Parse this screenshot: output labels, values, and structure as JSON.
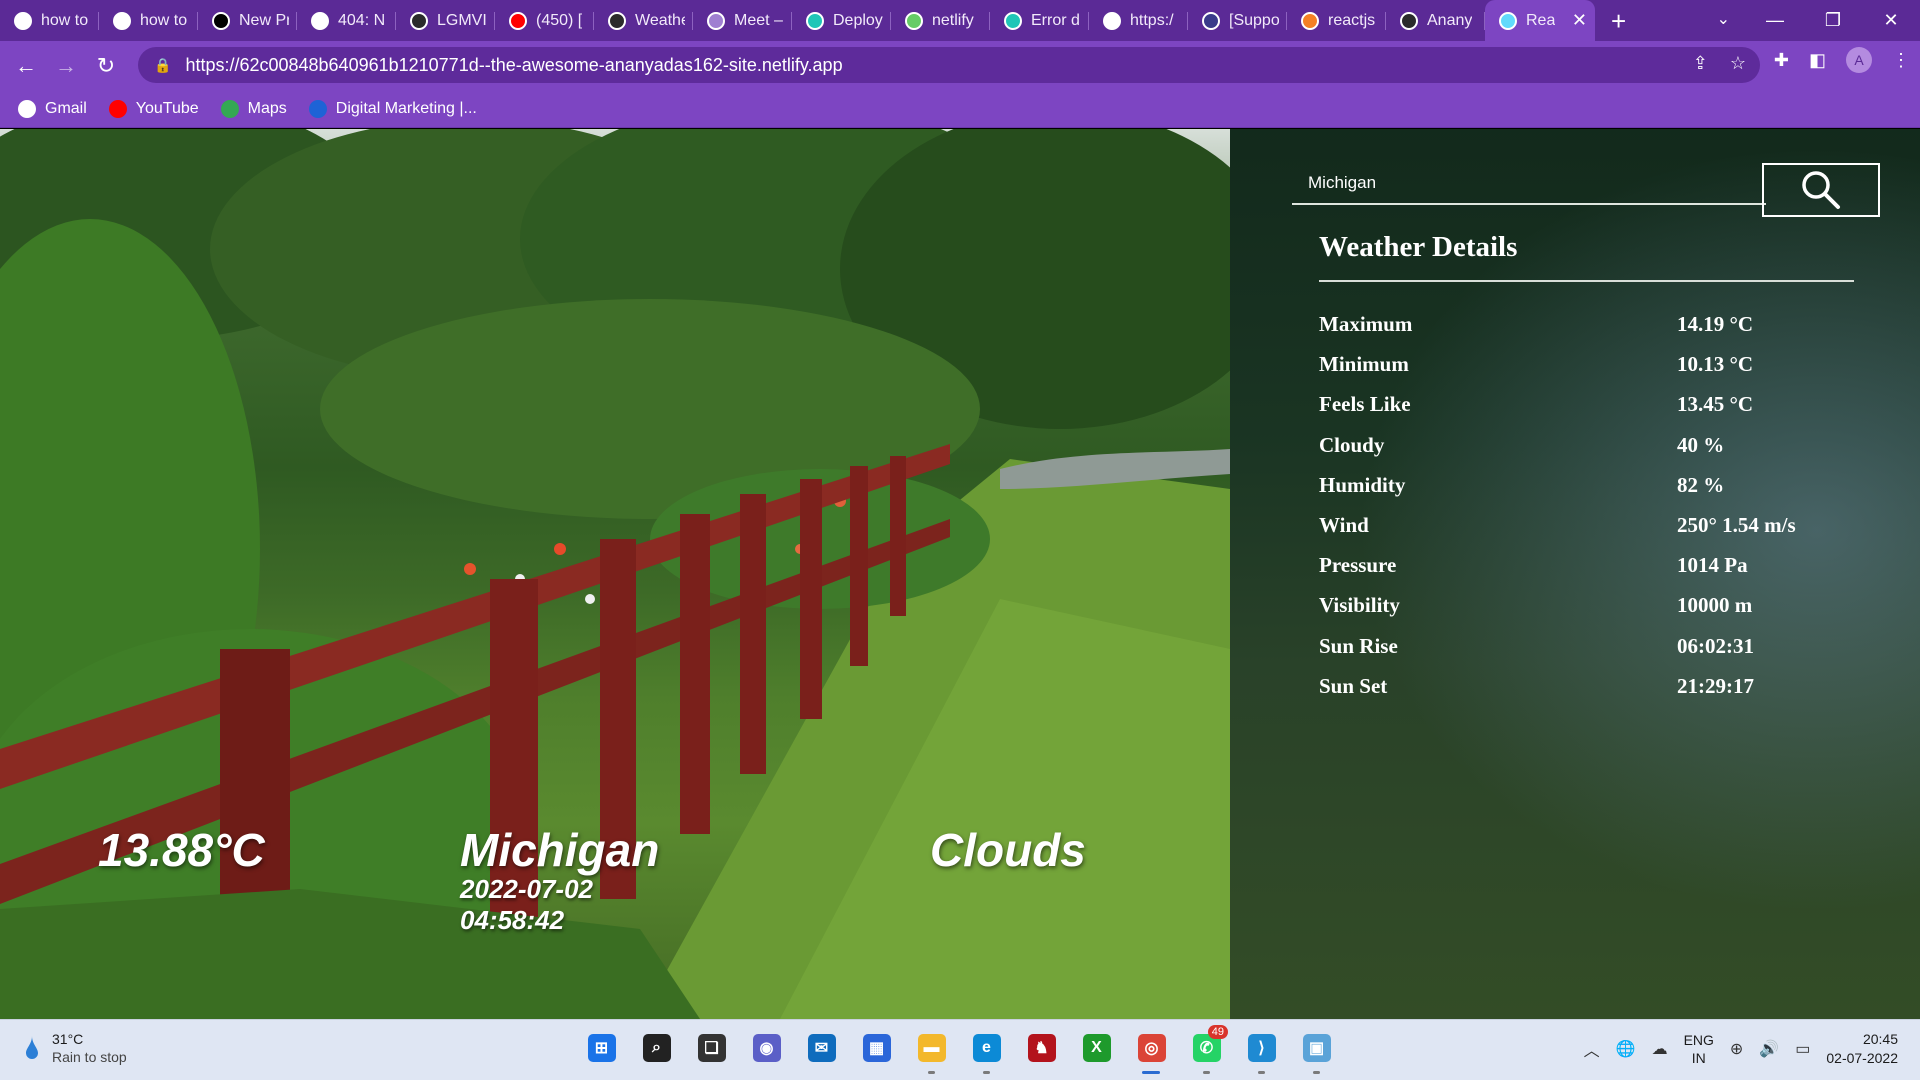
{
  "browser": {
    "tabs": [
      {
        "title": "how to",
        "icon": "google-icon",
        "color": "#ffffff"
      },
      {
        "title": "how to",
        "icon": "google-icon",
        "color": "#ffffff"
      },
      {
        "title": "New Pr",
        "icon": "vercel-icon",
        "color": "#000000"
      },
      {
        "title": "404: N",
        "icon": "globe-icon",
        "color": "#ffffff"
      },
      {
        "title": "LGMVI",
        "icon": "github-icon",
        "color": "#2b2b2b"
      },
      {
        "title": "(450) [",
        "icon": "youtube-icon",
        "color": "#ff0000"
      },
      {
        "title": "Weathe",
        "icon": "github-icon",
        "color": "#2b2b2b"
      },
      {
        "title": "Meet –",
        "icon": "loading-icon",
        "color": "#9f7fd1"
      },
      {
        "title": "Deploy",
        "icon": "netlify-icon",
        "color": "#20c6b7"
      },
      {
        "title": "netlify",
        "icon": "sparkle-icon",
        "color": "#66cc66"
      },
      {
        "title": "Error d",
        "icon": "netlify-icon",
        "color": "#20c6b7"
      },
      {
        "title": "https:/",
        "icon": "globe-icon",
        "color": "#ffffff"
      },
      {
        "title": "[Suppo",
        "icon": "support-icon",
        "color": "#3a3a8a"
      },
      {
        "title": "reactjs",
        "icon": "stackoverflow-icon",
        "color": "#f48024"
      },
      {
        "title": "Anany",
        "icon": "github-icon",
        "color": "#2b2b2b"
      },
      {
        "title": "Rea",
        "icon": "react-icon",
        "color": "#61dafb"
      }
    ],
    "url": "https://62c00848b640961b1210771d--the-awesome-ananyadas162-site.netlify.app",
    "bookmarks": [
      {
        "label": "Gmail",
        "icon": "google-icon",
        "color": "#ffffff"
      },
      {
        "label": "YouTube",
        "icon": "youtube-icon",
        "color": "#ff0000"
      },
      {
        "label": "Maps",
        "icon": "maps-icon",
        "color": "#34a853"
      },
      {
        "label": "Digital Marketing |...",
        "icon": "c-icon",
        "color": "#1e63d6"
      }
    ],
    "profile_initial": "A",
    "theme_color": "#7d45c2"
  },
  "search": {
    "value": "Michigan"
  },
  "details": {
    "title": "Weather Details",
    "rows": [
      {
        "label": "Maximum",
        "value": "14.19 °C"
      },
      {
        "label": "Minimum",
        "value": "10.13 °C"
      },
      {
        "label": "Feels Like",
        "value": "13.45 °C"
      },
      {
        "label": "Cloudy",
        "value": "40 %"
      },
      {
        "label": "Humidity",
        "value": "82 %"
      },
      {
        "label": "Wind",
        "value": "250° 1.54 m/s"
      },
      {
        "label": "Pressure",
        "value": "1014 Pa"
      },
      {
        "label": "Visibility",
        "value": "10000 m"
      },
      {
        "label": "Sun Rise",
        "value": "06:02:31"
      },
      {
        "label": "Sun Set",
        "value": "21:29:17"
      }
    ]
  },
  "hero": {
    "temperature": "13.88°C",
    "city": "Michigan",
    "date": "2022-07-02",
    "time": "04:58:42",
    "condition": "Clouds"
  },
  "taskbar": {
    "weather_temp": "31°C",
    "weather_desc": "Rain to stop",
    "apps": [
      {
        "name": "start-icon",
        "color": "#1a73e8"
      },
      {
        "name": "search-icon",
        "color": "#222222"
      },
      {
        "name": "task-view-icon",
        "color": "#333333"
      },
      {
        "name": "chat-icon",
        "color": "#5b5fc7"
      },
      {
        "name": "mail-icon",
        "color": "#0f6cbd"
      },
      {
        "name": "store-icon",
        "color": "#2b66d9"
      },
      {
        "name": "file-explorer-icon",
        "color": "#f3b82b"
      },
      {
        "name": "edge-icon",
        "color": "#0c8ad6"
      },
      {
        "name": "red-app-icon",
        "color": "#b3131c"
      },
      {
        "name": "xbox-icon",
        "color": "#1e9a2c"
      },
      {
        "name": "chrome-icon",
        "color": "#db4437"
      },
      {
        "name": "whatsapp-icon",
        "color": "#25d366"
      },
      {
        "name": "vscode-icon",
        "color": "#1f8ad2"
      },
      {
        "name": "control-panel-icon",
        "color": "#5aa3d8"
      }
    ],
    "whatsapp_badge": "49",
    "lang_primary": "ENG",
    "lang_secondary": "IN",
    "clock_time": "20:45",
    "clock_date": "02-07-2022"
  }
}
